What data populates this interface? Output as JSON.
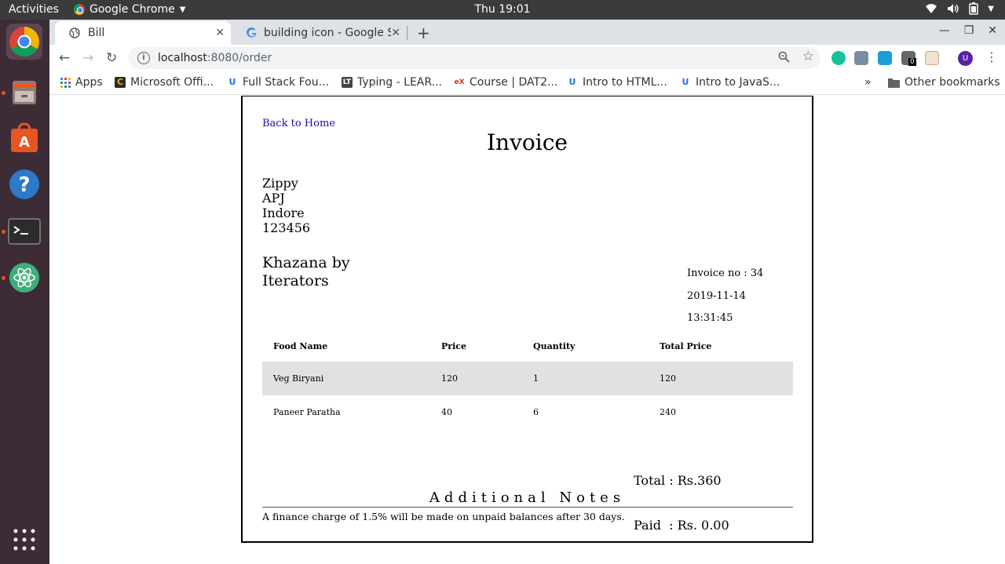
{
  "system": {
    "activities": "Activities",
    "app_name": "Google Chrome",
    "clock": "Thu 19:01"
  },
  "browser": {
    "tabs": [
      {
        "title": "Bill",
        "active": true
      },
      {
        "title": "building icon - Google Sea",
        "active": false
      }
    ],
    "new_tab": "+",
    "url_host": "localhost",
    "url_path": ":8080/order",
    "extension_badge": "0",
    "profile_initial": "U",
    "bookmarks": [
      {
        "label": "Apps",
        "icon": "apps-grid-icon"
      },
      {
        "label": "Microsoft Offi...",
        "icon": "office-icon"
      },
      {
        "label": "Full Stack Fou...",
        "icon": "udemy-icon"
      },
      {
        "label": "Typing - LEAR...",
        "icon": "typing-icon"
      },
      {
        "label": "Course | DAT2...",
        "icon": "edx-icon"
      },
      {
        "label": "Intro to HTML...",
        "icon": "udemy-icon"
      },
      {
        "label": "Intro to JavaS...",
        "icon": "udemy-icon"
      }
    ],
    "other_bookmarks": "Other bookmarks",
    "overflow": "»"
  },
  "invoice": {
    "back_link": "Back to Home",
    "title": "Invoice",
    "customer": {
      "name": "Zippy",
      "street": "APJ",
      "city": "Indore",
      "pin": "123456"
    },
    "store_name": "Khazana by Iterators",
    "invoice_no": "Invoice no : 34",
    "date": "2019-11-14",
    "time": "13:31:45",
    "table": {
      "headers": [
        "Food Name",
        "Price",
        "Quantity",
        "Total Price"
      ],
      "rows": [
        [
          "Veg Biryani",
          "120",
          "1",
          "120"
        ],
        [
          "Paneer Paratha",
          "40",
          "6",
          "240"
        ]
      ]
    },
    "total": "Total : Rs.360",
    "paid": "Paid  : Rs. 0.00",
    "notes_title": "Additional Notes",
    "notes_text": "A finance charge of 1.5% will be made on unpaid balances after 30 days."
  },
  "colors": {
    "dock_bg": "#3d2b36",
    "topbar_bg": "#3b3b3b",
    "accent_orange": "#e95420",
    "link": "#1a0dab",
    "row_shade": "#e1e1e1"
  }
}
